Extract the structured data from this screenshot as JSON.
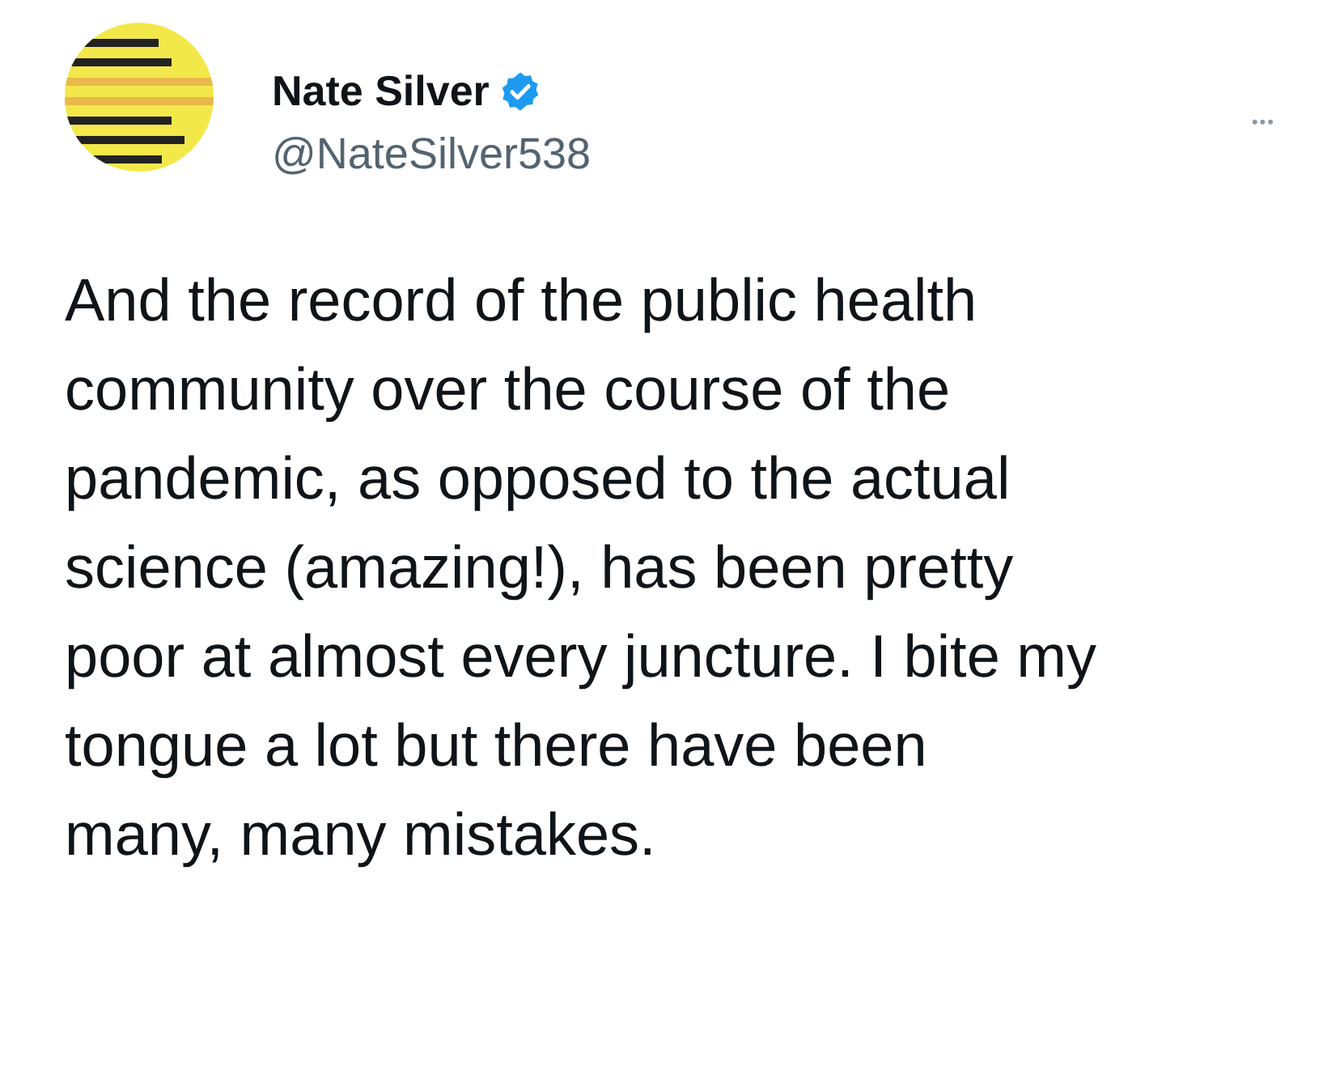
{
  "author": {
    "name": "Nate Silver",
    "verified": true,
    "handle": "@NateSilver538"
  },
  "more_button": "•••",
  "tweet_lines": [
    "And the record of the public health",
    "community over the course of the",
    "pandemic, as opposed to the actual",
    "science (amazing!), has been pretty",
    "poor at almost every juncture. I bite my",
    "tongue a lot but there have been",
    "many, many mistakes."
  ]
}
